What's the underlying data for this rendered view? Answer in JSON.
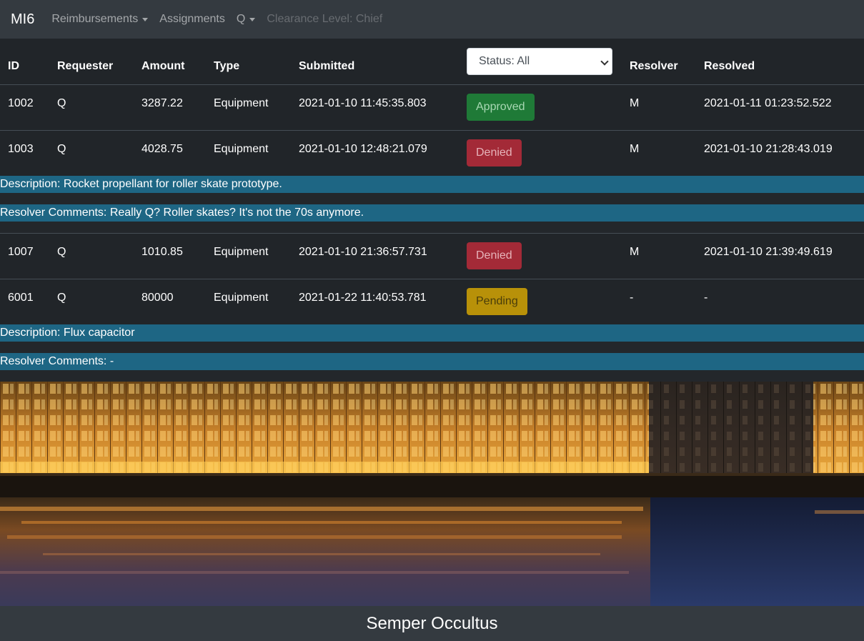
{
  "nav": {
    "brand": "MI6",
    "reimbursements": "Reimbursements",
    "assignments": "Assignments",
    "user": "Q",
    "clearance": "Clearance Level: Chief"
  },
  "table": {
    "headers": {
      "id": "ID",
      "requester": "Requester",
      "amount": "Amount",
      "type": "Type",
      "submitted": "Submitted",
      "resolver": "Resolver",
      "resolved": "Resolved"
    },
    "status_filter": "Status: All",
    "rows": [
      {
        "id": "1002",
        "requester": "Q",
        "amount": "3287.22",
        "type": "Equipment",
        "submitted": "2021-01-10 11:45:35.803",
        "status": "Approved",
        "resolver": "M",
        "resolved": "2021-01-11 01:23:52.522"
      },
      {
        "id": "1003",
        "requester": "Q",
        "amount": "4028.75",
        "type": "Equipment",
        "submitted": "2021-01-10 12:48:21.079",
        "status": "Denied",
        "resolver": "M",
        "resolved": "2021-01-10 21:28:43.019",
        "description": "Description: Rocket propellant for roller skate prototype.",
        "comments": "Resolver Comments: Really Q? Roller skates? It's not the 70s anymore."
      },
      {
        "id": "1007",
        "requester": "Q",
        "amount": "1010.85",
        "type": "Equipment",
        "submitted": "2021-01-10 21:36:57.731",
        "status": "Denied",
        "resolver": "M",
        "resolved": "2021-01-10 21:39:49.619"
      },
      {
        "id": "6001",
        "requester": "Q",
        "amount": "80000",
        "type": "Equipment",
        "submitted": "2021-01-22 11:40:53.781",
        "status": "Pending",
        "resolver": "-",
        "resolved": "-",
        "description": "Description: Flux capacitor",
        "comments": "Resolver Comments: -"
      }
    ]
  },
  "footer": {
    "motto": "Semper Occultus"
  },
  "colors": {
    "navbar": "#343a40",
    "table_bg": "#212529",
    "info_bar": "#1e6684",
    "approved": "#28a745",
    "denied": "#dc3545",
    "pending": "#ffc107"
  }
}
